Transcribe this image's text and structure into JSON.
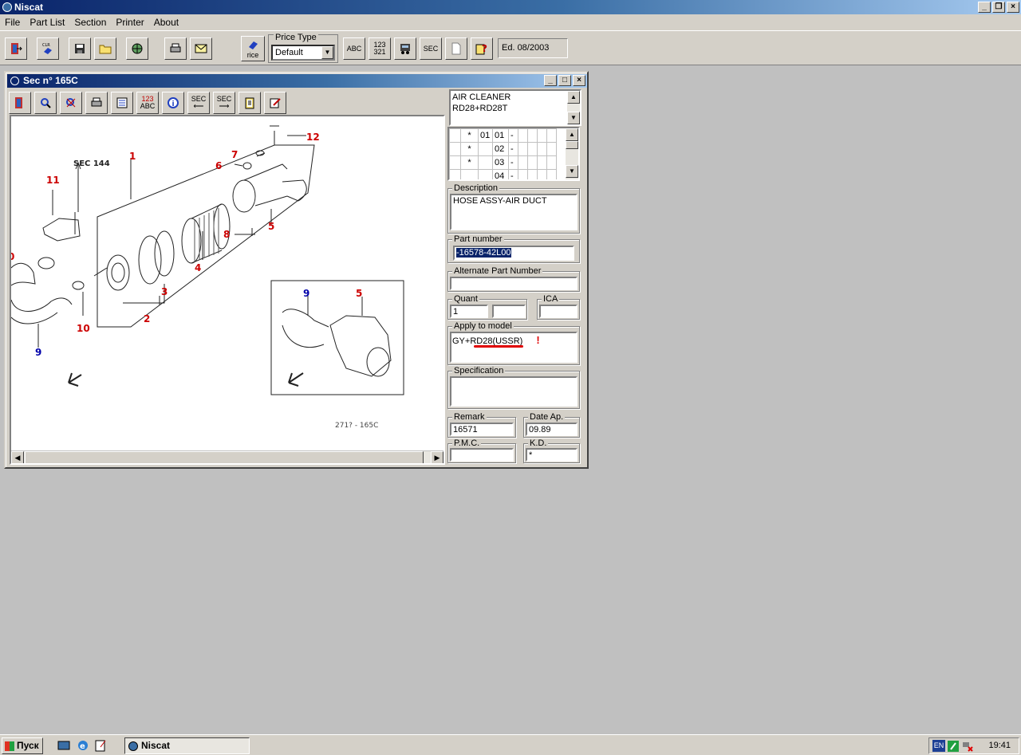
{
  "app": {
    "title": "Niscat"
  },
  "menu": [
    "File",
    "Part List",
    "Section",
    "Printer",
    "About"
  ],
  "toolbar": {
    "price_type_label": "Price Type",
    "price_type_value": "Default",
    "btn_abc": "ABC",
    "btn_123": "123\n321",
    "btn_sec": "SEC",
    "edition": "Ed. 08/2003",
    "price_btn": "rice"
  },
  "child": {
    "title": "Sec n° 165C",
    "toolbar": {
      "abc_top": "123",
      "abc_bottom": "ABC",
      "sec_prev": "SEC",
      "sec_next": "SEC"
    }
  },
  "drawing": {
    "sec_ref": "SEC 144",
    "callouts": [
      "1",
      "2",
      "3",
      "4",
      "5",
      "6",
      "7",
      "8",
      "9",
      "10",
      "11",
      "12",
      "0"
    ],
    "inset_callouts": [
      "9",
      "5"
    ],
    "footer_code": "271? - 165C"
  },
  "panel": {
    "section_name": [
      "AIR CLEANER",
      "RD28+RD28T"
    ],
    "grid_rows": [
      {
        "mark": "*",
        "code": "01",
        "ref": "01",
        "dash": "-"
      },
      {
        "mark": "*",
        "code": "",
        "ref": "02",
        "dash": "-"
      },
      {
        "mark": "*",
        "code": "",
        "ref": "03",
        "dash": "-"
      },
      {
        "mark": "",
        "code": "",
        "ref": "04",
        "dash": "-"
      }
    ],
    "description_label": "Description",
    "description": "HOSE ASSY-AIR DUCT",
    "part_number_label": "Part number",
    "part_number": "-16578-42L00",
    "alt_part_label": "Alternate Part Number",
    "alt_part": "",
    "quant_label": "Quant",
    "quant": "1",
    "quant2": "",
    "ica_label": "ICA",
    "ica": "",
    "apply_label": "Apply to model",
    "apply_value": "GY+RD28(USSR)",
    "apply_mark": "!",
    "spec_label": "Specification",
    "spec": "",
    "remark_label": "Remark",
    "remark": "16571",
    "date_label": "Date Ap.",
    "date": "09.89",
    "pmc_label": "P.M.C.",
    "pmc": "",
    "kd_label": "K.D.",
    "kd": "*"
  },
  "taskbar": {
    "start": "Пуск",
    "task": "Niscat",
    "lang": "EN",
    "time": "19:41"
  },
  "colors": {
    "title_start": "#0a246a",
    "title_end": "#a6caf0",
    "callout_red": "#cc0000",
    "callout_blue": "#0000aa",
    "selection": "#0a246a"
  }
}
